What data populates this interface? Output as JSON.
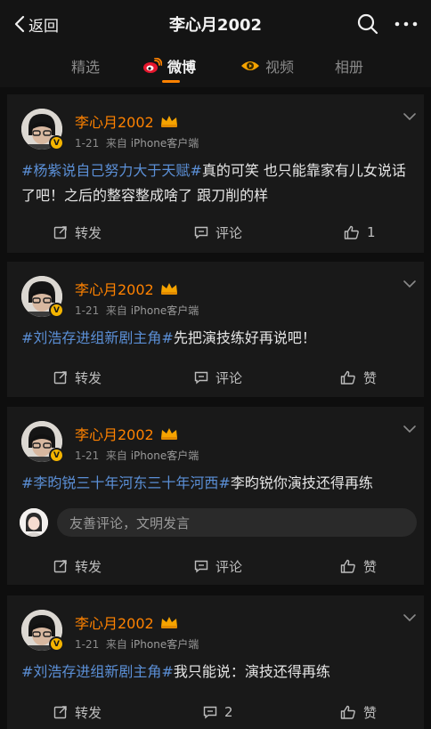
{
  "header": {
    "back_label": "返回",
    "title": "李心月2002"
  },
  "tabs": [
    {
      "label": "精选",
      "active": false
    },
    {
      "label": "微博",
      "active": true
    },
    {
      "label": "视频",
      "active": false
    },
    {
      "label": "相册",
      "active": false
    }
  ],
  "colors": {
    "accent": "#ff8200",
    "topic": "#5b8fd6",
    "background": "#0e0e0e",
    "card": "#191919"
  },
  "posts": [
    {
      "user": "李心月2002",
      "date": "1-21",
      "source_prefix": "来自",
      "source": "iPhone客户端",
      "topic": "#杨紫说自己努力大于天赋#",
      "text": "真的可笑 也只能靠家有儿女说话了吧！之后的整容整成啥了 跟刀削的样",
      "repost_label": "转发",
      "comment_label": "评论",
      "like_label": "1"
    },
    {
      "user": "李心月2002",
      "date": "1-21",
      "source_prefix": "来自",
      "source": "iPhone客户端",
      "topic": "#刘浩存进组新剧主角#",
      "text": "先把演技练好再说吧！",
      "repost_label": "转发",
      "comment_label": "评论",
      "like_label": "赞"
    },
    {
      "user": "李心月2002",
      "date": "1-21",
      "source_prefix": "来自",
      "source": "iPhone客户端",
      "topic": "#李昀锐三十年河东三十年河西#",
      "text": "李昀锐你演技还得再练",
      "comment_placeholder": "友善评论，文明发言",
      "repost_label": "转发",
      "comment_label": "评论",
      "like_label": "赞"
    },
    {
      "user": "李心月2002",
      "date": "1-21",
      "source_prefix": "来自",
      "source": "iPhone客户端",
      "topic": "#刘浩存进组新剧主角#",
      "text": "我只能说：演技还得再练",
      "repost_label": "转发",
      "comment_label": "2",
      "like_label": "赞"
    }
  ]
}
